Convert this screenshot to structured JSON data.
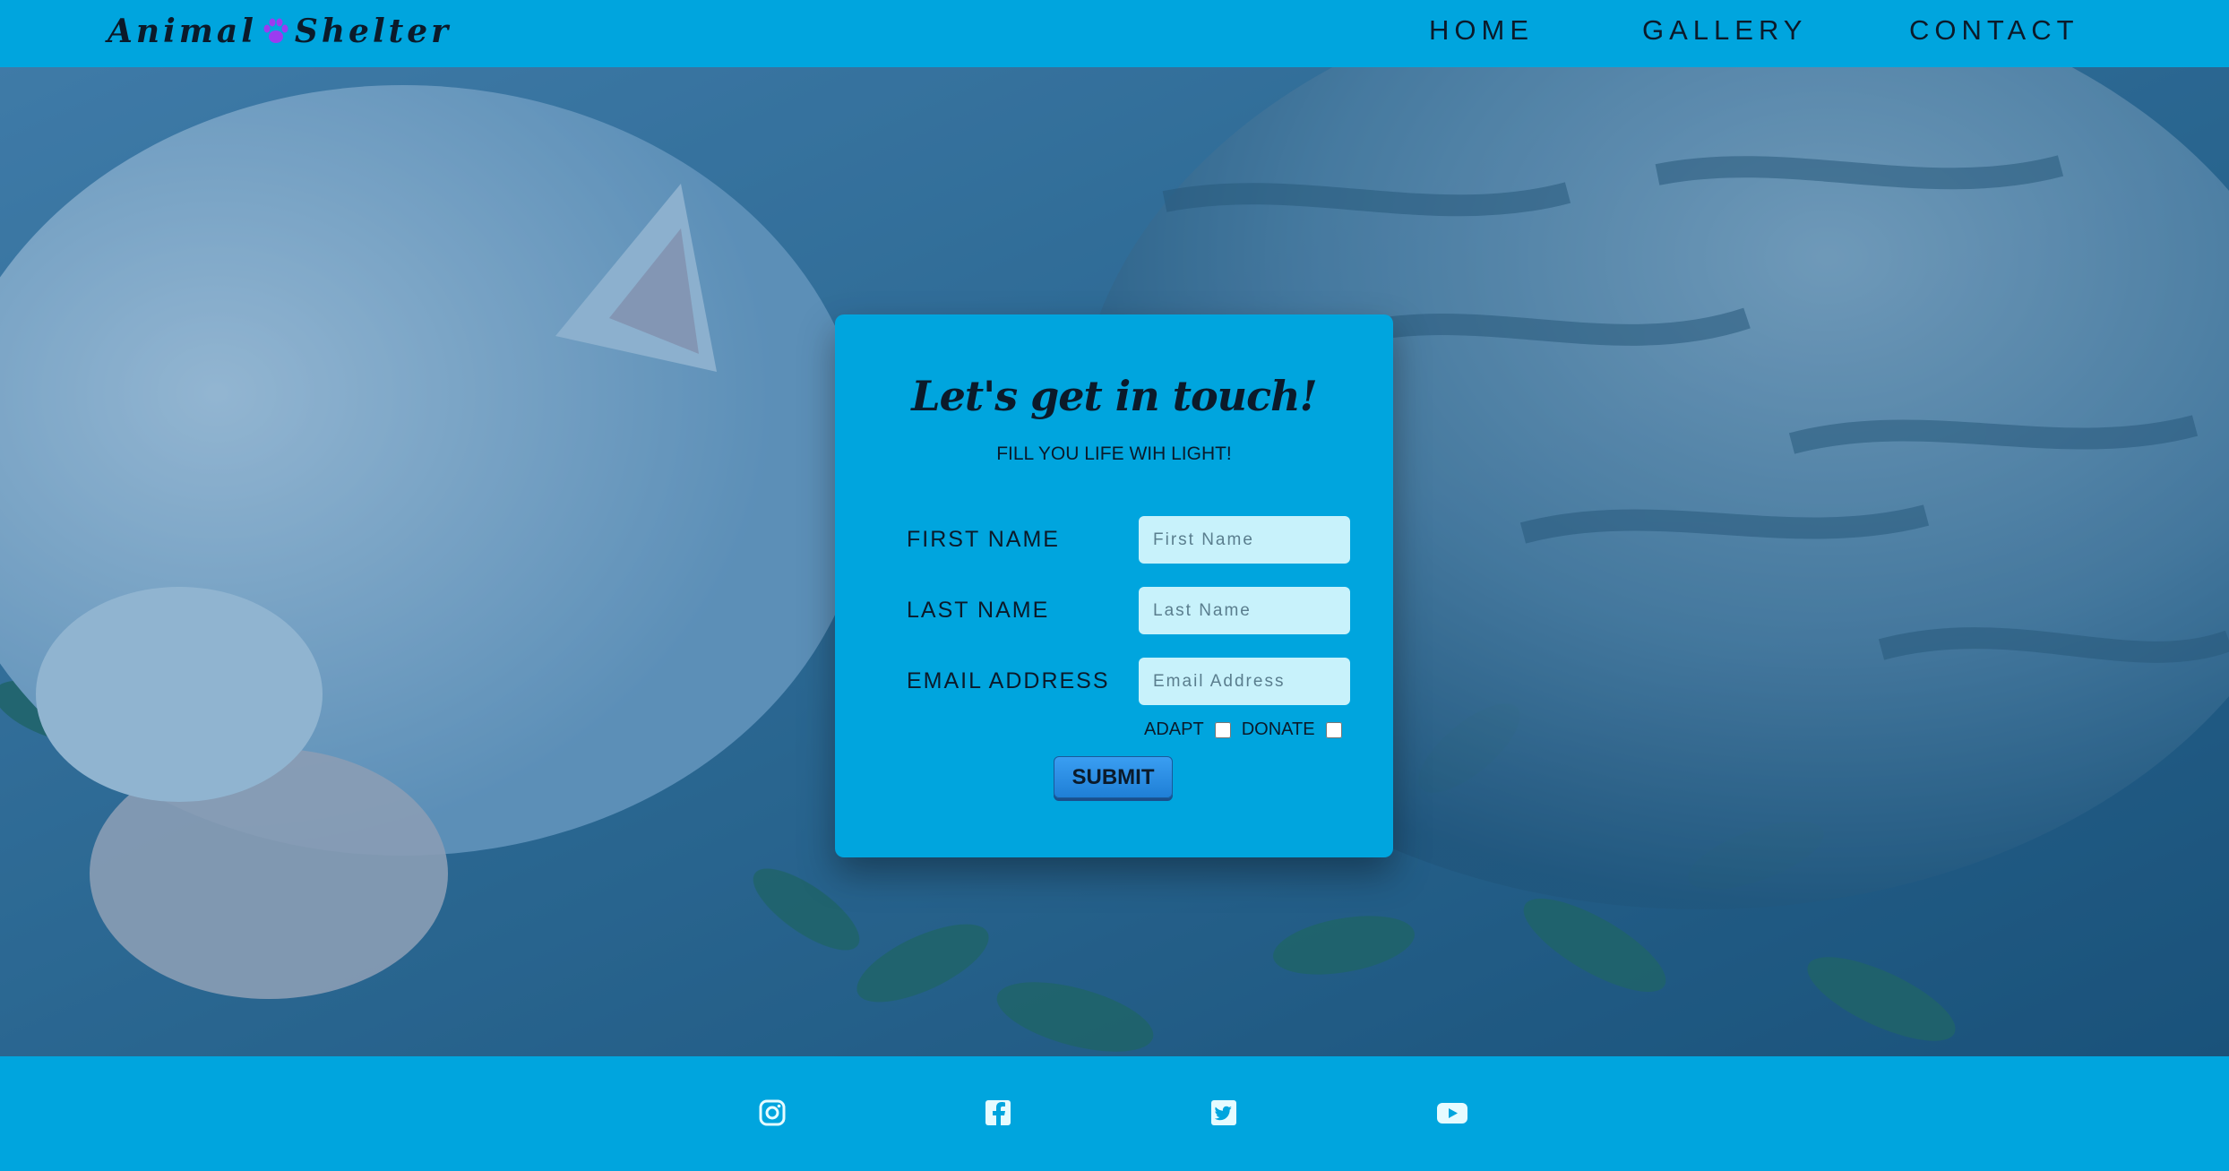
{
  "header": {
    "logo_left": "Animal",
    "logo_right": "Shelter",
    "logo_icon": "paw-icon",
    "nav": [
      "HOME",
      "GALLERY",
      "CONTACT"
    ]
  },
  "form": {
    "title": "Let's get in touch!",
    "subtitle": "FILL YOU LIFE WIH LIGHT!",
    "fields": [
      {
        "label": "FIRST NAME",
        "placeholder": "First Name",
        "value": ""
      },
      {
        "label": "LAST NAME",
        "placeholder": "Last Name",
        "value": ""
      },
      {
        "label": "EMAIL ADDRESS",
        "placeholder": "Email Address",
        "value": ""
      }
    ],
    "checkboxes": [
      {
        "label": "ADAPT",
        "checked": false
      },
      {
        "label": "DONATE",
        "checked": false
      }
    ],
    "submit_label": "SUBMIT"
  },
  "footer": {
    "icons": [
      "instagram-icon",
      "facebook-icon",
      "twitter-icon",
      "youtube-icon"
    ]
  },
  "colors": {
    "brand": "#00a5de",
    "input_bg": "#c8f2fb",
    "button": "#2b8ae6",
    "paw": "#9b3cf0",
    "text": "#0b1a2a",
    "footer_icons": "#e6fbff"
  }
}
